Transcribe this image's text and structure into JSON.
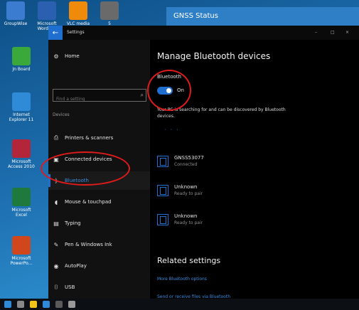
{
  "desktop": {
    "icons": [
      {
        "label": "GroupWise",
        "color": "#3b7bd0"
      },
      {
        "label": "Microsoft Word 2...",
        "color": "#2b5fb0"
      },
      {
        "label": "VLC media",
        "color": "#f08a0a"
      },
      {
        "label": "5",
        "color": "#6a6a6a"
      },
      {
        "label": "Jn Board",
        "color": "#3aa83a"
      },
      {
        "label": "Internet Explorer 11",
        "color": "#2f8bd8"
      },
      {
        "label": "Microsoft Access 2010",
        "color": "#b3263a"
      },
      {
        "label": "Microsoft Excel",
        "color": "#1e7a3c"
      },
      {
        "label": "Microsoft PowerPo...",
        "color": "#d0461d"
      }
    ]
  },
  "gnss_window": {
    "title": "GNSS Status"
  },
  "settings": {
    "window_title": "Settings",
    "controls": {
      "minimize": "–",
      "maximize": "□",
      "close": "×"
    },
    "sidebar": {
      "home_label": "Home",
      "search_placeholder": "Find a setting",
      "section_label": "Devices",
      "items": [
        {
          "label": "Printers & scanners",
          "icon": "printer-icon"
        },
        {
          "label": "Connected devices",
          "icon": "connected-devices-icon"
        },
        {
          "label": "Bluetooth",
          "icon": "bluetooth-icon"
        },
        {
          "label": "Mouse & touchpad",
          "icon": "mouse-icon"
        },
        {
          "label": "Typing",
          "icon": "keyboard-icon"
        },
        {
          "label": "Pen & Windows Ink",
          "icon": "pen-icon"
        },
        {
          "label": "AutoPlay",
          "icon": "autoplay-icon"
        },
        {
          "label": "USB",
          "icon": "usb-icon"
        }
      ],
      "selected": "Bluetooth"
    },
    "main": {
      "title": "Manage Bluetooth devices",
      "bluetooth_label": "Bluetooth",
      "toggle_state": "On",
      "status_text": "Your PC is searching for and can be discovered by Bluetooth devices.",
      "devices": [
        {
          "name": "GNSS53077",
          "status": "Connected"
        },
        {
          "name": "Unknown",
          "status": "Ready to pair"
        },
        {
          "name": "Unknown",
          "status": "Ready to pair"
        }
      ],
      "related_title": "Related settings",
      "links": [
        "More Bluetooth options",
        "Send or receive files via Bluetooth"
      ]
    }
  },
  "colors": {
    "accent": "#1f6fd1",
    "annotation": "#e01b1b"
  }
}
